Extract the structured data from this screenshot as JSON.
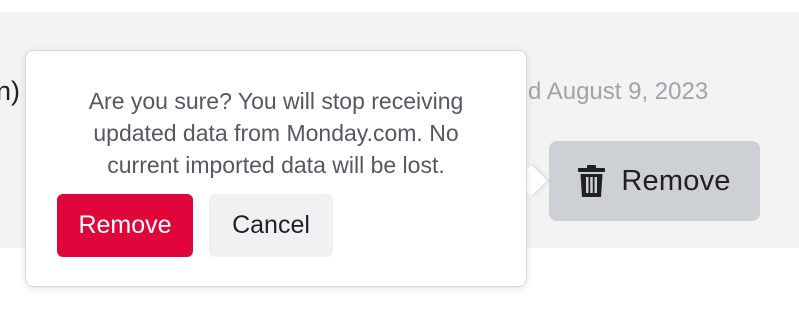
{
  "background_row": {
    "name_fragment": "n)",
    "updated_text": "ted August 9, 2023",
    "remove_button": {
      "icon": "trash-icon",
      "label": "Remove"
    }
  },
  "popover": {
    "message_lines": [
      "Are you sure? You will stop receiving",
      "updated data from Monday.com. No",
      "current imported data will be lost."
    ],
    "confirm_label": "Remove",
    "cancel_label": "Cancel"
  },
  "colors": {
    "danger": "#e0063c",
    "secondary_button": "#cdd0d4",
    "cancel_button": "#f1f1f3",
    "muted_text": "#a1a3aa",
    "strip_background": "#f3f3f4"
  }
}
